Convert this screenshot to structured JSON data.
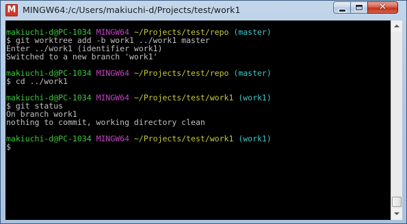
{
  "window": {
    "icon_letter": "M",
    "title": "MINGW64:/c/Users/makiuchi-d/Projects/test/work1",
    "minimize_label": "",
    "maximize_label": "",
    "close_label": "✕"
  },
  "console": {
    "blocks": [
      {
        "prompt": {
          "user": "makiuchi-d@PC-1034",
          "host": "MINGW64",
          "path": "~/Projects/test/repo",
          "branch": "(master)"
        },
        "command": "$ git worktree add -b work1 ../work1 master",
        "output": [
          "Enter ../work1 (identifier work1)",
          "Switched to a new branch 'work1'"
        ]
      },
      {
        "prompt": {
          "user": "makiuchi-d@PC-1034",
          "host": "MINGW64",
          "path": "~/Projects/test/repo",
          "branch": "(master)"
        },
        "command": "$ cd ../work1",
        "output": []
      },
      {
        "prompt": {
          "user": "makiuchi-d@PC-1034",
          "host": "MINGW64",
          "path": "~/Projects/test/work1",
          "branch": "(work1)"
        },
        "command": "$ git status",
        "output": [
          "On branch work1",
          "nothing to commit, working directory clean"
        ]
      },
      {
        "prompt": {
          "user": "makiuchi-d@PC-1034",
          "host": "MINGW64",
          "path": "~/Projects/test/work1",
          "branch": "(work1)"
        },
        "command": "$",
        "output": []
      }
    ]
  },
  "colors": {
    "user": "#3ec83e",
    "host": "#c83ec8",
    "path": "#c8c83e",
    "branch": "#3ec8c8",
    "text": "#c0c0c0",
    "background": "#000000"
  },
  "scrollbar": {
    "position": 1.0
  }
}
